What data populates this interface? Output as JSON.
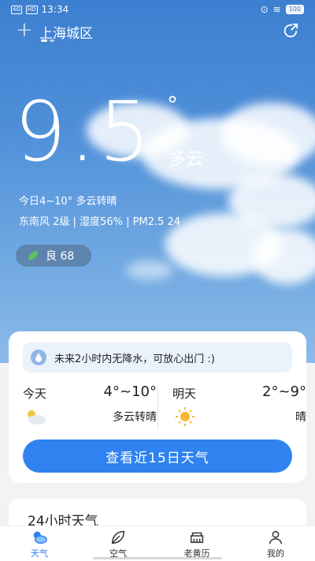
{
  "status": {
    "time": "13:34",
    "network": "4G",
    "hd": "HD",
    "battery": "100"
  },
  "header": {
    "city": "上海城区",
    "add_symbol": "+"
  },
  "current": {
    "temperature": "9.5",
    "unit": "°",
    "condition": "多云",
    "summary": "今日4~10° 多云转晴",
    "details": "东南风 2级 | 湿度56% | PM2.5 24",
    "aqi_label": "良 68"
  },
  "forecast_card": {
    "rain_notice": "未来2小时内无降水，可放心出门 :)",
    "today": {
      "label": "今天",
      "range": "4°~10°",
      "condition": "多云转晴",
      "icon": "partly-cloudy-icon"
    },
    "tomorrow": {
      "label": "明天",
      "range": "2°~9°",
      "condition": "晴",
      "icon": "sun-icon"
    },
    "cta": "查看近15日天气"
  },
  "hourly": {
    "title": "24小时天气"
  },
  "tabs": [
    {
      "label": "天气",
      "icon": "weather-icon",
      "active": true
    },
    {
      "label": "空气",
      "icon": "leaf-icon",
      "active": false
    },
    {
      "label": "老黄历",
      "icon": "almanac-icon",
      "active": false
    },
    {
      "label": "我的",
      "icon": "profile-icon",
      "active": false
    }
  ],
  "colors": {
    "accent": "#2f82f0",
    "sky": "#4f8fd9",
    "aqi_good": "#5cc15c"
  }
}
